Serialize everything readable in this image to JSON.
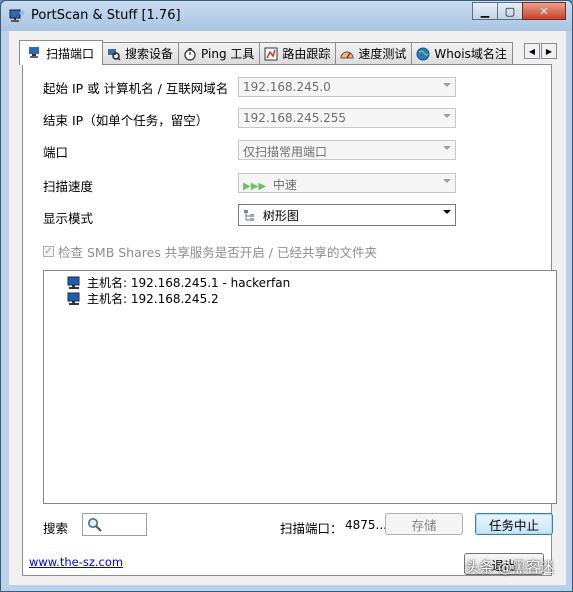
{
  "window": {
    "title": "PortScan & Stuff [1.76]"
  },
  "tabs": [
    {
      "label": "扫描端口",
      "icon": "network-icon",
      "active": true
    },
    {
      "label": "搜索设备",
      "icon": "search-devices-icon"
    },
    {
      "label": "Ping 工具",
      "icon": "stopwatch-icon"
    },
    {
      "label": "路由跟踪",
      "icon": "route-icon"
    },
    {
      "label": "速度测试",
      "icon": "speedometer-icon"
    },
    {
      "label": "Whois域名注",
      "icon": "globe-icon"
    }
  ],
  "form": {
    "start_label": "起始 IP 或 计算机名 / 互联网域名",
    "start_value": "192.168.245.0",
    "end_label": "结束 IP（如单个任务，留空）",
    "end_value": "192.168.245.255",
    "port_label": "端口",
    "port_value": "仅扫描常用端口",
    "speed_label": "扫描速度",
    "speed_value": "中速",
    "mode_label": "显示模式",
    "mode_value": "树形图"
  },
  "smb_check": {
    "label": "检查 SMB Shares 共享服务是否开启 / 已经共享的文件夹",
    "checked": true
  },
  "results": [
    {
      "text": "主机名: 192.168.245.1 - hackerfan"
    },
    {
      "text": "主机名: 192.168.245.2"
    }
  ],
  "footer": {
    "search_label": "搜索",
    "ports_label": "扫描端口：",
    "ports_value": "4875...",
    "save_label": "存储",
    "stop_label": "任务中止",
    "link_text": "www.the-sz.com",
    "exit_label": "退出"
  },
  "watermark": "头条 @黑客迷"
}
